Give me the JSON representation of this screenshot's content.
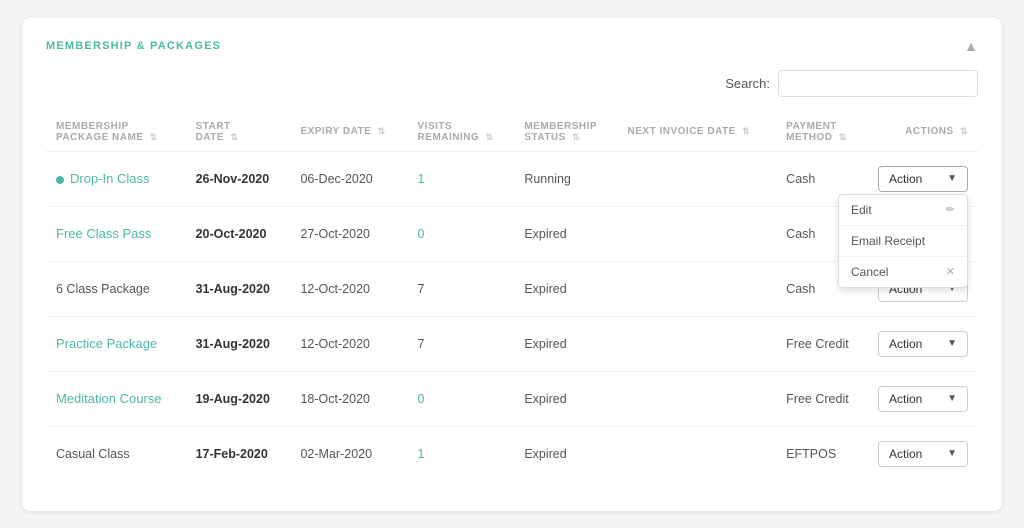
{
  "card": {
    "title": "MEMBERSHIP & PACKAGES",
    "collapse_icon": "▲"
  },
  "search": {
    "label": "Search:",
    "placeholder": ""
  },
  "table": {
    "columns": [
      {
        "id": "package_name",
        "label": "MEMBERSHIP PACKAGE NAME",
        "sortable": true
      },
      {
        "id": "start_date",
        "label": "START DATE",
        "sortable": true
      },
      {
        "id": "expiry_date",
        "label": "EXPIRY DATE",
        "sortable": true
      },
      {
        "id": "visits_remaining",
        "label": "VISITS REMAINING",
        "sortable": true
      },
      {
        "id": "membership_status",
        "label": "MEMBERSHIP STATUS",
        "sortable": true
      },
      {
        "id": "next_invoice_date",
        "label": "NEXT INVOICE DATE",
        "sortable": true
      },
      {
        "id": "payment_method",
        "label": "PAYMENT METHOD",
        "sortable": true
      },
      {
        "id": "actions",
        "label": "ACTIONS",
        "sortable": true
      }
    ],
    "rows": [
      {
        "id": 1,
        "package_name": "Drop-In Class",
        "has_dot": true,
        "start_date": "26-Nov-2020",
        "expiry_date": "06-Dec-2020",
        "visits_remaining": "1",
        "visits_is_link": true,
        "membership_status": "Running",
        "next_invoice_date": "",
        "payment_method": "Cash",
        "action_open": true
      },
      {
        "id": 2,
        "package_name": "Free Class Pass",
        "has_dot": false,
        "start_date": "20-Oct-2020",
        "expiry_date": "27-Oct-2020",
        "visits_remaining": "0",
        "visits_is_link": true,
        "membership_status": "Expired",
        "next_invoice_date": "",
        "payment_method": "Cash",
        "action_open": false
      },
      {
        "id": 3,
        "package_name": "6 Class Package",
        "has_dot": false,
        "start_date": "31-Aug-2020",
        "expiry_date": "12-Oct-2020",
        "visits_remaining": "7",
        "visits_is_link": false,
        "membership_status": "Expired",
        "next_invoice_date": "",
        "payment_method": "Cash",
        "action_open": false
      },
      {
        "id": 4,
        "package_name": "Practice Package",
        "has_dot": false,
        "start_date": "31-Aug-2020",
        "expiry_date": "12-Oct-2020",
        "visits_remaining": "7",
        "visits_is_link": false,
        "membership_status": "Expired",
        "next_invoice_date": "",
        "payment_method": "Free Credit",
        "action_open": false
      },
      {
        "id": 5,
        "package_name": "Meditation Course",
        "has_dot": false,
        "start_date": "19-Aug-2020",
        "expiry_date": "18-Oct-2020",
        "visits_remaining": "0",
        "visits_is_link": true,
        "membership_status": "Expired",
        "next_invoice_date": "",
        "payment_method": "Free Credit",
        "action_open": false
      },
      {
        "id": 6,
        "package_name": "Casual Class",
        "has_dot": false,
        "start_date": "17-Feb-2020",
        "expiry_date": "02-Mar-2020",
        "visits_remaining": "1",
        "visits_is_link": true,
        "membership_status": "Expired",
        "next_invoice_date": "",
        "payment_method": "EFTPOS",
        "action_open": false
      }
    ],
    "action_button_label": "Action",
    "dropdown_items": [
      {
        "label": "Edit",
        "icon": "✏"
      },
      {
        "label": "Email Receipt",
        "icon": ""
      },
      {
        "label": "Cancel",
        "icon": "✕"
      }
    ]
  }
}
